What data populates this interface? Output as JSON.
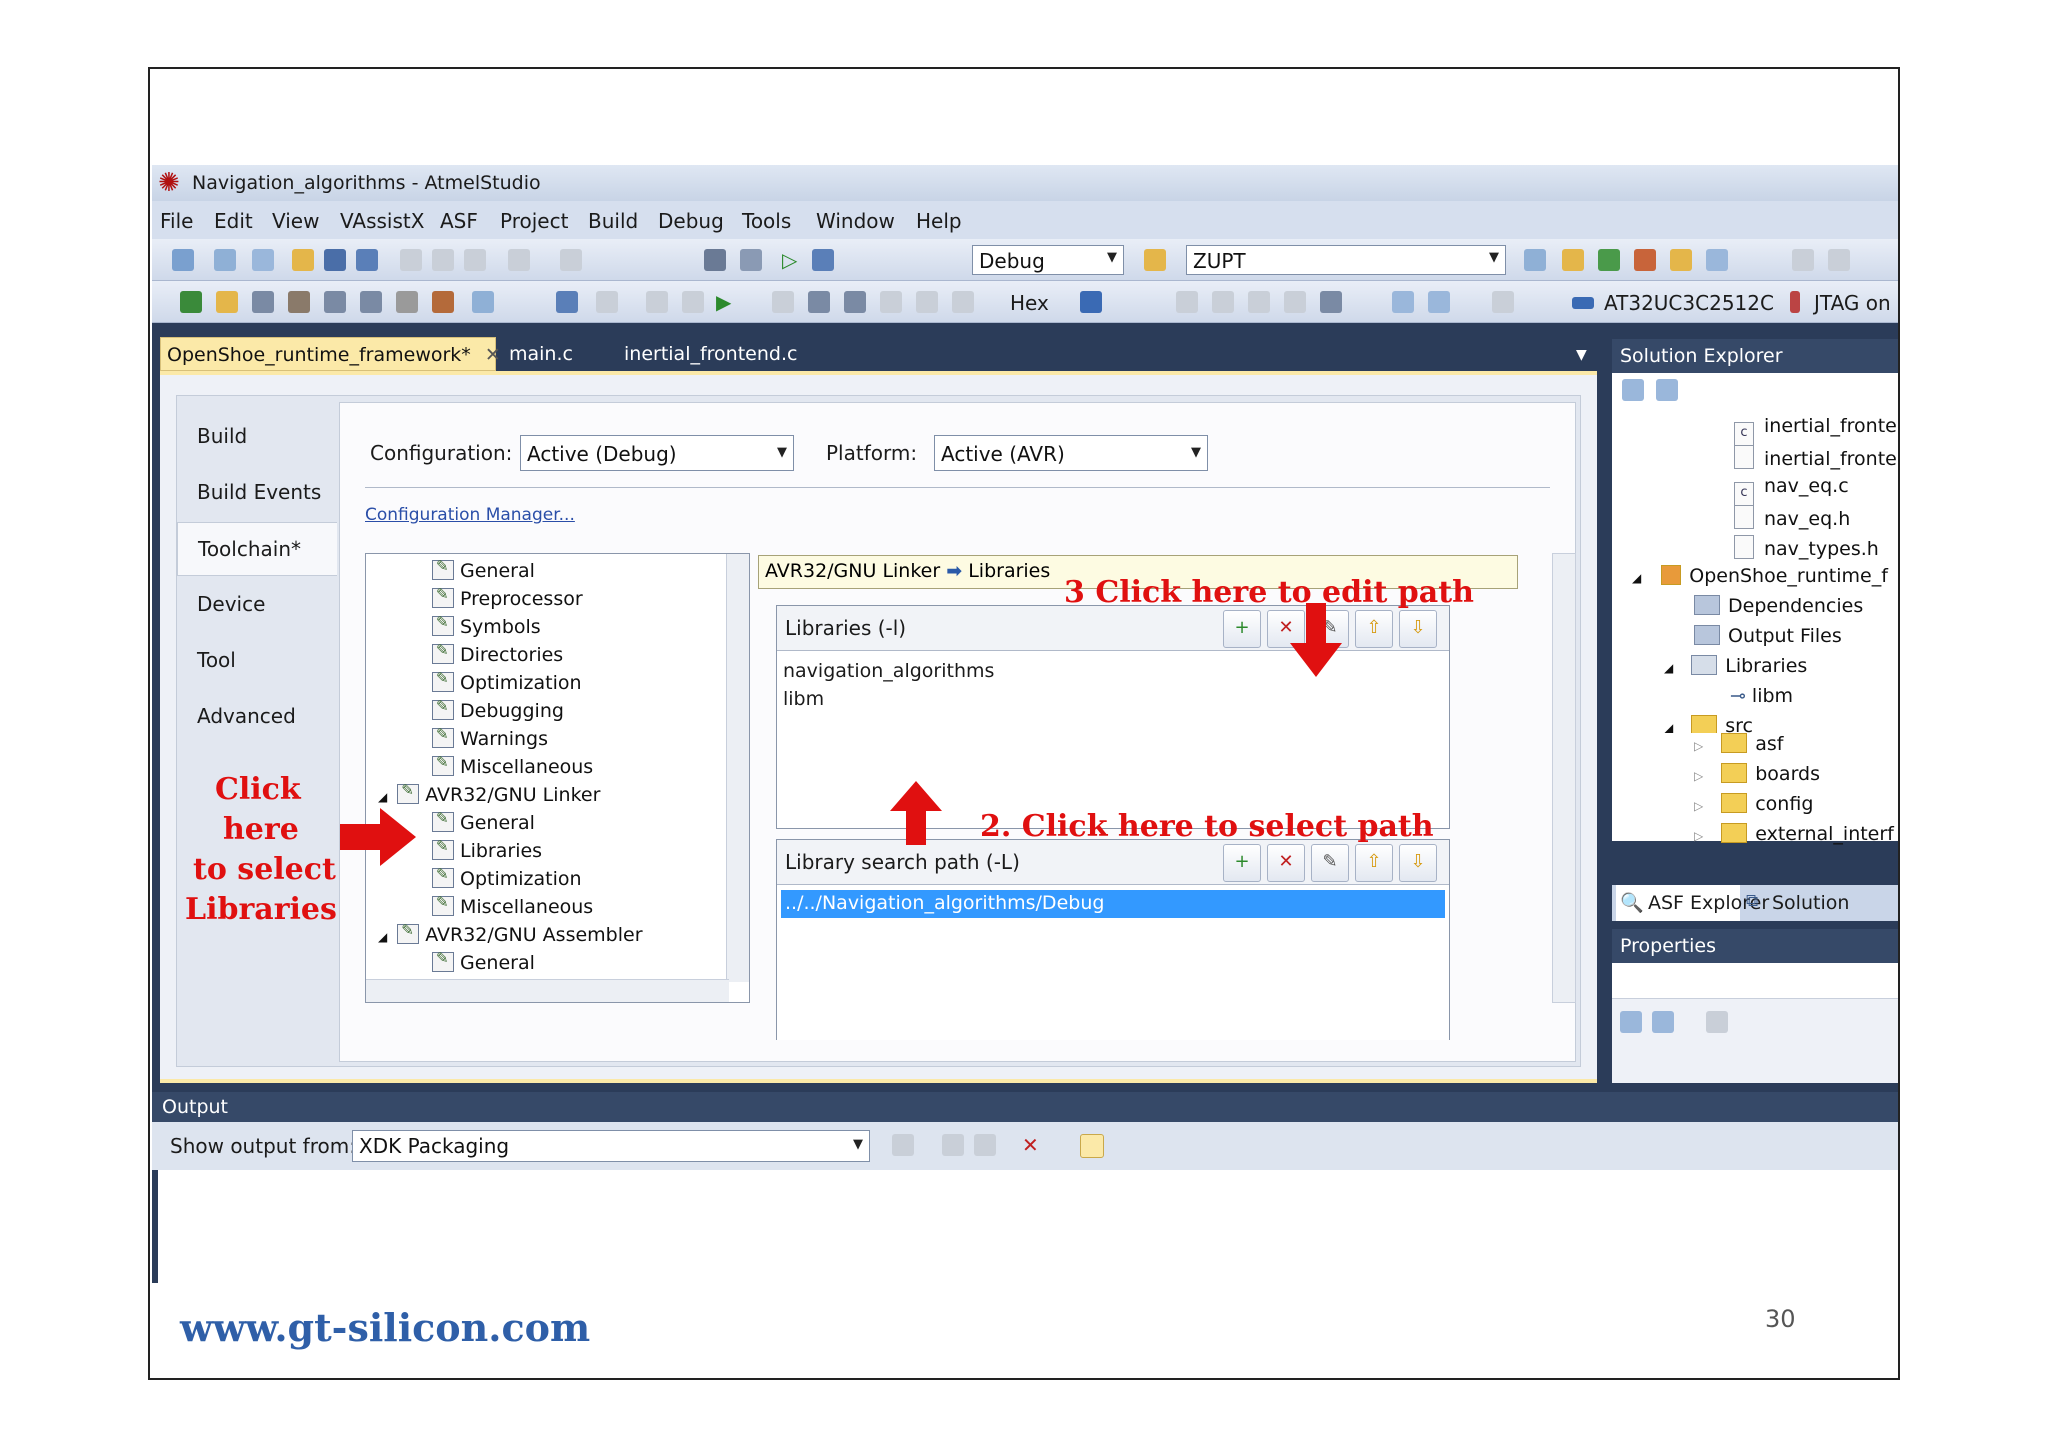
{
  "window": {
    "title": "Navigation_algorithms - AtmelStudio"
  },
  "menu": [
    "File",
    "Edit",
    "View",
    "VAssistX",
    "ASF",
    "Project",
    "Build",
    "Debug",
    "Tools",
    "Window",
    "Help"
  ],
  "toolbar": {
    "config_combo": "Debug",
    "search_combo": "ZUPT",
    "hex_label": "Hex",
    "device_label": "AT32UC3C2512C",
    "tool_label": "JTAG on"
  },
  "tabs": {
    "active": "OpenShoe_runtime_framework*",
    "tab2": "main.c",
    "tab3": "inertial_frontend.c"
  },
  "side_tabs": [
    "Build",
    "Build Events",
    "Toolchain*",
    "Device",
    "Tool",
    "Advanced"
  ],
  "config": {
    "configuration_label": "Configuration:",
    "configuration_value": "Active (Debug)",
    "platform_label": "Platform:",
    "platform_value": "Active (AVR)",
    "manager_link": "Configuration Manager..."
  },
  "tree": {
    "items": [
      "General",
      "Preprocessor",
      "Symbols",
      "Directories",
      "Optimization",
      "Debugging",
      "Warnings",
      "Miscellaneous"
    ],
    "linker": "AVR32/GNU Linker",
    "linker_items": [
      "General",
      "Libraries",
      "Optimization",
      "Miscellaneous"
    ],
    "assembler": "AVR32/GNU Assembler",
    "assembler_items": [
      "General"
    ]
  },
  "breadcrumb": {
    "part1": "AVR32/GNU Linker",
    "part2": "Libraries"
  },
  "libraries": {
    "title": "Libraries (-l)",
    "items": [
      "navigation_algorithms",
      "libm"
    ]
  },
  "search_path": {
    "title": "Library search path (-L)",
    "selected": "../../Navigation_algorithms/Debug"
  },
  "annotations": {
    "left": [
      "Click",
      "here",
      "to select",
      "Libraries"
    ],
    "edit_path": "3 Click here to edit path",
    "select_path": "2. Click here to select path"
  },
  "solution_explorer": {
    "title": "Solution Explorer",
    "files": [
      "inertial_fronte",
      "inertial_fronte",
      "nav_eq.c",
      "nav_eq.h",
      "nav_types.h"
    ],
    "project": "OpenShoe_runtime_f",
    "nodes": [
      "Dependencies",
      "Output Files",
      "Libraries",
      "libm",
      "src",
      "asf",
      "boards",
      "config",
      "external_interf"
    ],
    "tab1": "ASF Explorer",
    "tab2": "Solution"
  },
  "properties": {
    "title": "Properties"
  },
  "output": {
    "title": "Output",
    "show_label": "Show output from:",
    "source": "XDK Packaging"
  },
  "footer": {
    "website": "www.gt-silicon.com",
    "page": "30"
  }
}
